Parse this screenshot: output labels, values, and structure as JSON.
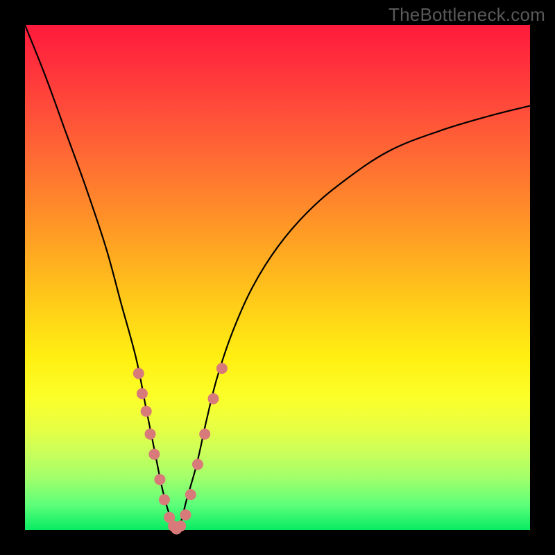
{
  "watermark": "TheBottleneck.com",
  "colors": {
    "background": "#000000",
    "curve": "#000000",
    "dots": "#d97a7a",
    "gradient_top": "#ff1a3c",
    "gradient_bottom": "#07eb62"
  },
  "chart_data": {
    "type": "line",
    "title": "",
    "xlabel": "",
    "ylabel": "",
    "xlim": [
      0,
      100
    ],
    "ylim": [
      0,
      100
    ],
    "grid": false,
    "series": [
      {
        "name": "bottleneck-curve",
        "x": [
          0,
          4,
          8,
          12,
          16,
          19,
          22,
          24,
          26,
          27,
          28,
          29,
          30,
          31,
          32,
          34,
          36,
          38,
          41,
          45,
          50,
          56,
          63,
          72,
          82,
          92,
          100
        ],
        "y": [
          100,
          90,
          79,
          68,
          56,
          45,
          34,
          24,
          14,
          9,
          5,
          2,
          0,
          2,
          6,
          13,
          22,
          30,
          39,
          48,
          56,
          63,
          69,
          75,
          79,
          82,
          84
        ]
      }
    ],
    "dots": [
      {
        "x": 22.5,
        "y": 31
      },
      {
        "x": 23.2,
        "y": 27
      },
      {
        "x": 24.0,
        "y": 23.5
      },
      {
        "x": 24.8,
        "y": 19
      },
      {
        "x": 25.6,
        "y": 15
      },
      {
        "x": 26.7,
        "y": 10
      },
      {
        "x": 27.6,
        "y": 6
      },
      {
        "x": 28.6,
        "y": 2.5
      },
      {
        "x": 29.4,
        "y": 0.8
      },
      {
        "x": 30.0,
        "y": 0.2
      },
      {
        "x": 30.8,
        "y": 0.8
      },
      {
        "x": 31.8,
        "y": 3
      },
      {
        "x": 32.8,
        "y": 7
      },
      {
        "x": 34.2,
        "y": 13
      },
      {
        "x": 35.6,
        "y": 19
      },
      {
        "x": 37.3,
        "y": 26
      },
      {
        "x": 39.0,
        "y": 32
      }
    ]
  }
}
